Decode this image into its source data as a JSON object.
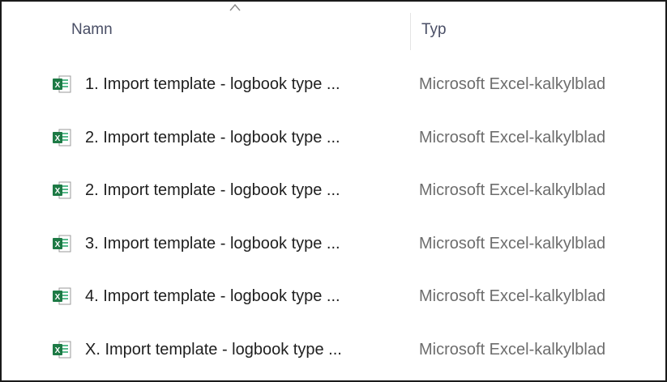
{
  "header": {
    "sort_icon": "chevron-up-icon",
    "columns": {
      "name": "Namn",
      "type": "Typ"
    }
  },
  "files": [
    {
      "name": "1. Import template - logbook type ...",
      "type": "Microsoft Excel-kalkylblad",
      "icon": "excel-file-icon"
    },
    {
      "name": "2. Import template - logbook type ...",
      "type": "Microsoft Excel-kalkylblad",
      "icon": "excel-file-icon"
    },
    {
      "name": "2. Import template - logbook type ...",
      "type": "Microsoft Excel-kalkylblad",
      "icon": "excel-file-icon"
    },
    {
      "name": "3. Import template - logbook type ...",
      "type": "Microsoft Excel-kalkylblad",
      "icon": "excel-file-icon"
    },
    {
      "name": "4. Import template - logbook type ...",
      "type": "Microsoft Excel-kalkylblad",
      "icon": "excel-file-icon"
    },
    {
      "name": "X. Import template - logbook type ...",
      "type": "Microsoft Excel-kalkylblad",
      "icon": "excel-file-icon"
    }
  ],
  "colors": {
    "excel_green": "#1d7a45",
    "header_text": "#4a4f66",
    "type_text": "#6d6d6d"
  }
}
